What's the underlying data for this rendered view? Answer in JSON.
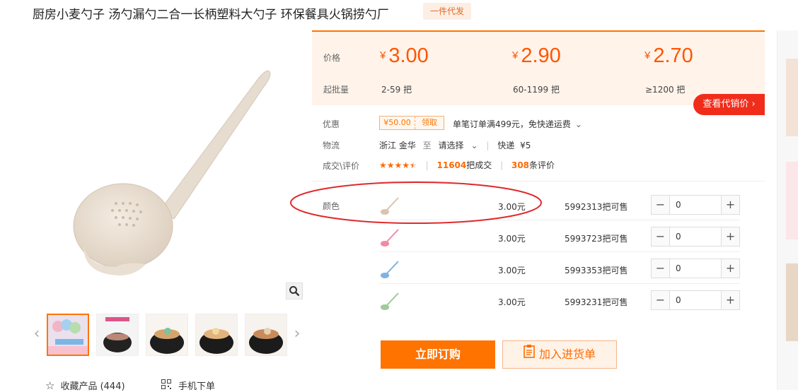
{
  "header": {
    "title": "厨房小麦勺子 汤勺漏勺二合一长柄塑料大勺子 环保餐具火锅捞勺厂",
    "dropship_tag": "一件代发"
  },
  "price_box": {
    "price_label": "价格",
    "moq_label": "起批量",
    "currency": "¥",
    "tiers": [
      {
        "price": "3.00",
        "qty": "2-59",
        "unit": "把"
      },
      {
        "price": "2.90",
        "qty": "60-1199",
        "unit": "把"
      },
      {
        "price": "2.70",
        "qty": "≥1200",
        "unit": "把"
      }
    ],
    "dropship_button": "查看代销价 ›"
  },
  "promo": {
    "label": "优惠",
    "coupon_value": "¥50.00",
    "coupon_claim": "领取",
    "text": "单笔订单满499元，免快递运费"
  },
  "logistics": {
    "label": "物流",
    "origin": "浙江 金华",
    "to": "至",
    "destination": "请选择",
    "method": "快递",
    "fee": "¥5"
  },
  "deals": {
    "label": "成交\\评价",
    "rating": 4.5,
    "orders_count": "11604",
    "orders_text": "把成交",
    "reviews_count": "308",
    "reviews_text": "条评价"
  },
  "sku": {
    "color_label": "颜色",
    "rows": [
      {
        "price": "3.00元",
        "stock": "5992313把可售",
        "qty": "0",
        "color": "#d9c4ae"
      },
      {
        "price": "3.00元",
        "stock": "5993723把可售",
        "qty": "0",
        "color": "#f08aa6"
      },
      {
        "price": "3.00元",
        "stock": "5993353把可售",
        "qty": "0",
        "color": "#7fb3e0"
      },
      {
        "price": "3.00元",
        "stock": "5993231把可售",
        "qty": "0",
        "color": "#9ccc9a"
      }
    ]
  },
  "actions": {
    "buy_now": "立即订购",
    "add_to_cart": "加入进货单"
  },
  "footer": {
    "favorite": "收藏产品 (444)",
    "mobile_order": "手机下单"
  },
  "colors": {
    "accent": "#ff7300",
    "red_button": "#f02d1a",
    "annotation": "#e0282a"
  }
}
